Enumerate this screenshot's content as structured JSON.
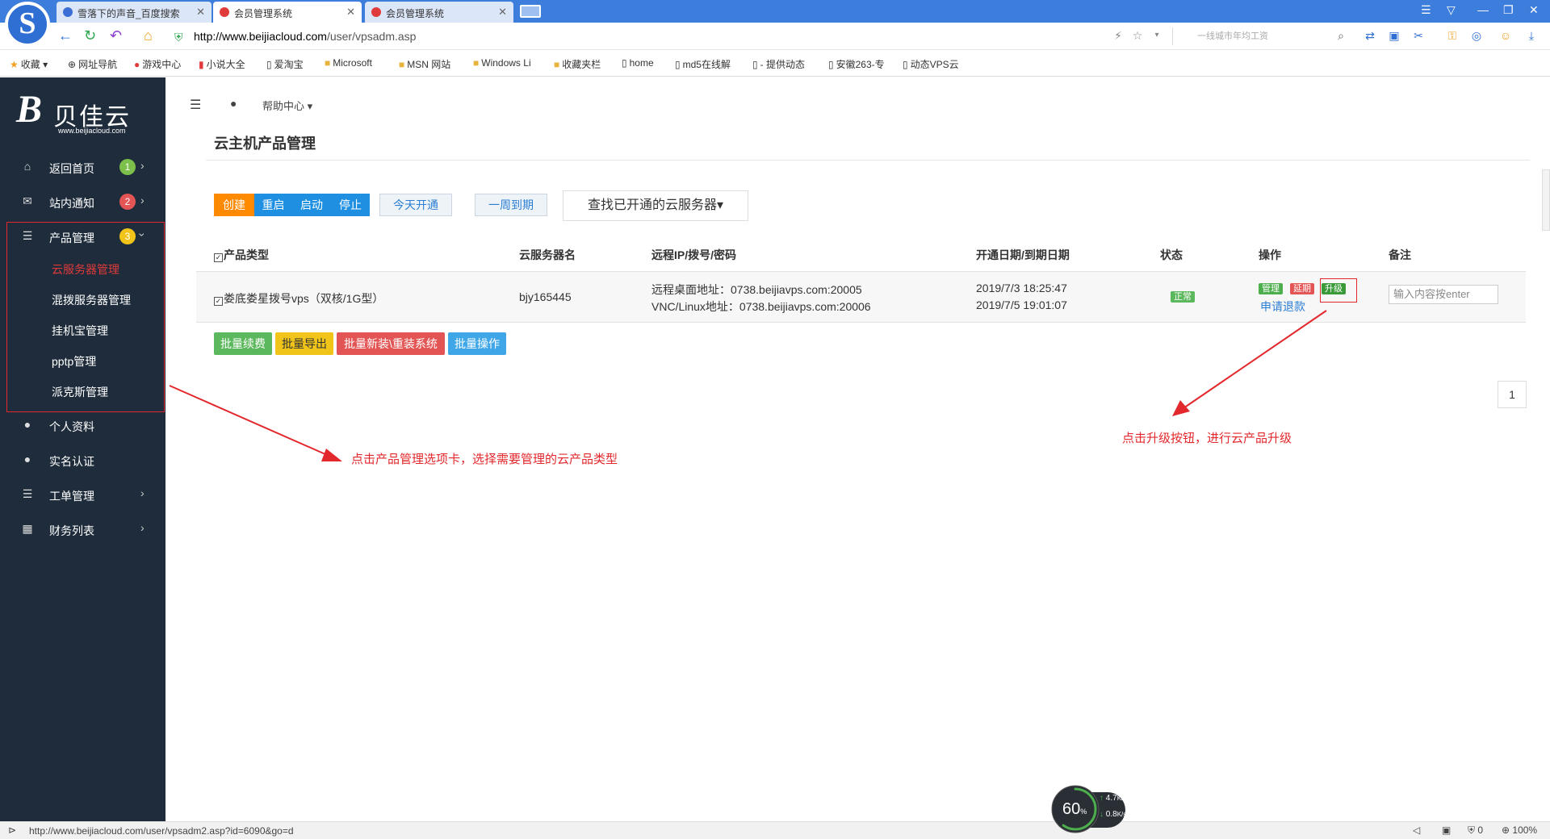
{
  "browser": {
    "tabs": [
      {
        "title": "雪落下的声音_百度搜索",
        "fav_color": "#3b6fd6"
      },
      {
        "title": "会员管理系统",
        "fav_color": "#e03b3b"
      },
      {
        "title": "会员管理系统",
        "fav_color": "#e03b3b"
      }
    ],
    "url_host": "http://www.beijiacloud.com",
    "url_path": "/user/vpsadm.asp",
    "search_placeholder": "一线城市年均工资",
    "bookmarks": [
      "收藏",
      "网址导航",
      "游戏中心",
      "小说大全",
      "爱淘宝",
      "Microsoft",
      "MSN 网站",
      "Windows Li",
      "收藏夹栏",
      "home",
      "md5在线解",
      "- 提供动态",
      "安徽263-专",
      "动态VPS云"
    ]
  },
  "sidebar": {
    "brand_name": "贝佳云",
    "brand_url": "www.beijiacloud.com",
    "items": [
      {
        "label": "返回首页",
        "badge": "1",
        "icon": "home-icon"
      },
      {
        "label": "站内通知",
        "badge": "2",
        "icon": "envelope-icon"
      },
      {
        "label": "产品管理",
        "badge": "3",
        "icon": "server-icon"
      },
      {
        "label": "个人资料",
        "icon": "user-icon"
      },
      {
        "label": "实名认证",
        "icon": "user-icon"
      },
      {
        "label": "工单管理",
        "icon": "list-icon"
      },
      {
        "label": "财务列表",
        "icon": "table-icon"
      }
    ],
    "subitems": [
      "云服务器管理",
      "混拨服务器管理",
      "挂机宝管理",
      "pptp管理",
      "派克斯管理"
    ]
  },
  "topbar": {
    "help": "帮助中心"
  },
  "page": {
    "title": "云主机产品管理",
    "buttons": {
      "create": "创建",
      "restart": "重启",
      "start": "启动",
      "stop": "停止",
      "today": "今天开通",
      "week": "一周到期",
      "find": "查找已开通的云服务器"
    },
    "headers": [
      "产品类型",
      "云服务器名",
      "远程IP/拨号/密码",
      "开通日期/到期日期",
      "状态",
      "操作",
      "备注"
    ],
    "row": {
      "type": "娄底娄星拨号vps（双核/1G型）",
      "name": "bjy165445",
      "remote1": "远程桌面地址：0738.beijiavps.com:20005",
      "remote2": "VNC/Linux地址：0738.beijiavps.com:20006",
      "date_open": "2019/7/3 18:25:47",
      "date_expire": "2019/7/5 19:01:07",
      "status": "正常",
      "op_manage": "管理",
      "op_extend": "延期",
      "op_upgrade": "升级",
      "op_refund": "申请退款",
      "note_placeholder": "输入内容按enter"
    },
    "batch": {
      "renew": "批量续费",
      "export": "批量导出",
      "reinstall": "批量新装\\重装系统",
      "ops": "批量操作"
    },
    "page_number": "1"
  },
  "annotations": {
    "left": "点击产品管理选项卡，选择需要管理的云产品类型",
    "right": "点击升级按钮，进行云产品升级"
  },
  "status": {
    "url": "http://www.beijiacloud.com/user/vpsadm2.asp?id=6090&go=d",
    "gauge_value": "60",
    "gauge_unit": "%",
    "up_speed": "4.7",
    "down_speed": "0.8",
    "speed_unit": "K/s",
    "shield_count": "0",
    "zoom": "100%"
  },
  "colors": {
    "sidebar": "#1e2c3b",
    "orange": "#ff8a00",
    "blue": "#1e8fe1",
    "green": "#5cb85c",
    "yellow": "#f0c419",
    "red": "#e35454",
    "annotation": "#e2282c"
  }
}
